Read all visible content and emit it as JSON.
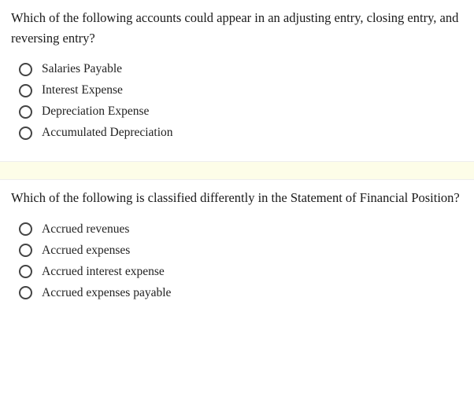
{
  "questions": [
    {
      "prompt": "Which of the following accounts could appear in an adjusting entry, closing entry, and reversing entry?",
      "options": [
        "Salaries Payable",
        "Interest Expense",
        "Depreciation Expense",
        "Accumulated Depreciation"
      ]
    },
    {
      "prompt": "Which of the following is classified differently in the Statement of Financial Position?",
      "options": [
        "Accrued revenues",
        "Accrued expenses",
        "Accrued interest expense",
        "Accrued expenses payable"
      ]
    }
  ]
}
